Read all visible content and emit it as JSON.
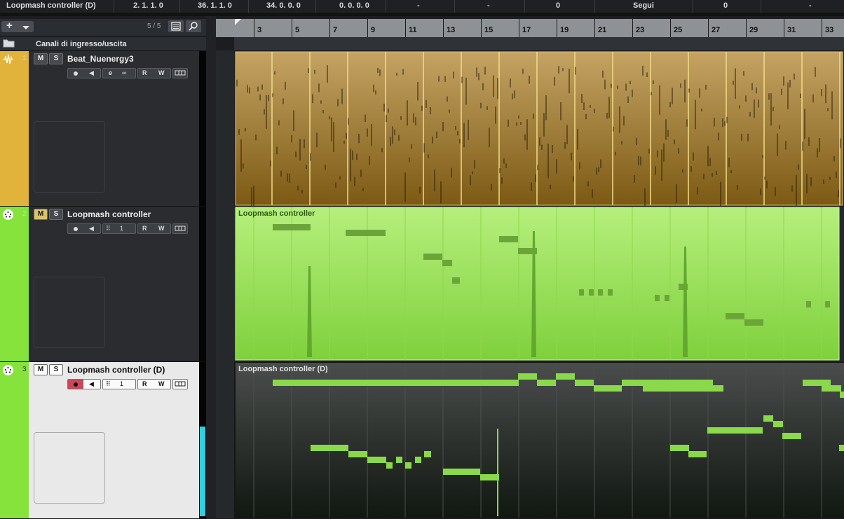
{
  "infobar": {
    "cells": [
      "Loopmash controller (D)",
      "2.  1.  1.    0",
      "36.  1.  1.    0",
      "34.  0.  0.    0",
      "0.  0.  0.    0",
      "-",
      "-",
      "0",
      "Segui",
      "0",
      "-"
    ]
  },
  "toolbar": {
    "add_label": "+",
    "track_count": "5 / 5"
  },
  "io_folder": {
    "label": "Canali di ingresso/uscita"
  },
  "tracks": [
    {
      "number": "1",
      "name": "Beat_Nuenergy3",
      "type": "audio",
      "color": "#e2b33a",
      "mute": "M",
      "solo": "S",
      "read": "R",
      "write": "W",
      "selected": false
    },
    {
      "number": "2",
      "name": "Loopmash controller",
      "type": "midi",
      "color": "#86e33b",
      "mute": "M",
      "solo": "S",
      "read": "R",
      "write": "W",
      "channel": "1",
      "selected": false
    },
    {
      "number": "3",
      "name": "Loopmash controller (D)",
      "type": "midi",
      "color": "#86e33b",
      "mute": "M",
      "solo": "S",
      "read": "R",
      "write": "W",
      "channel": "1",
      "selected": true
    }
  ],
  "ruler": {
    "start_marker": "1",
    "bars": [
      "3",
      "5",
      "7",
      "9",
      "11",
      "13",
      "15",
      "17",
      "19",
      "21",
      "23",
      "25",
      "27",
      "29",
      "31",
      "33"
    ]
  },
  "parts": {
    "audio": {
      "color": "#9b7a2a"
    },
    "midi": {
      "label": "Loopmash controller",
      "color": "#9be15a"
    },
    "midi_d": {
      "label": "Loopmash controller (D)",
      "note_color": "#8ad94a"
    }
  },
  "colors": {
    "accent": "#86e33b",
    "audio": "#e2b33a",
    "record": "#c84858",
    "meter": "#2fd0e0"
  }
}
